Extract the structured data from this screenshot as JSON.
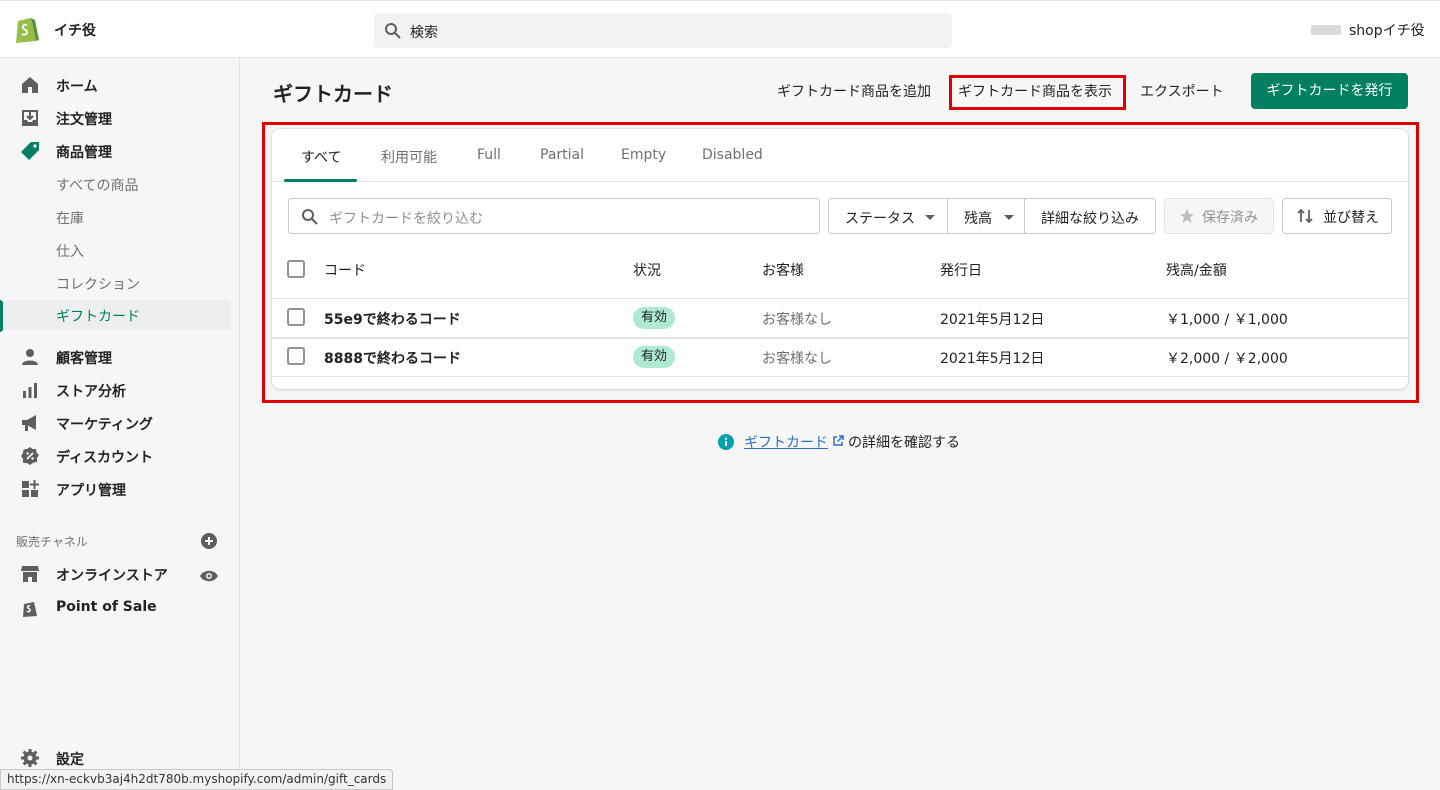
{
  "header": {
    "store_name": "イチ役",
    "search_placeholder": "検索",
    "shop_name": "shopイチ役"
  },
  "sidebar": {
    "items": [
      {
        "label": "ホーム",
        "icon": "home-icon"
      },
      {
        "label": "注文管理",
        "icon": "orders-icon"
      },
      {
        "label": "商品管理",
        "icon": "tag-icon"
      },
      {
        "label": "顧客管理",
        "icon": "customer-icon"
      },
      {
        "label": "ストア分析",
        "icon": "analytics-icon"
      },
      {
        "label": "マーケティング",
        "icon": "megaphone-icon"
      },
      {
        "label": "ディスカウント",
        "icon": "discount-icon"
      },
      {
        "label": "アプリ管理",
        "icon": "apps-icon"
      }
    ],
    "sub_items": [
      "すべての商品",
      "在庫",
      "仕入",
      "コレクション",
      "ギフトカード"
    ],
    "sales_channels_title": "販売チャネル",
    "channels": [
      {
        "label": "オンラインストア",
        "icon": "store-icon"
      },
      {
        "label": "Point of Sale",
        "icon": "pos-icon"
      }
    ],
    "settings_label": "設定"
  },
  "page": {
    "title": "ギフトカード",
    "actions": {
      "add_product": "ギフトカード商品を追加",
      "view_products": "ギフトカード商品を表示",
      "export": "エクスポート",
      "issue": "ギフトカードを発行"
    }
  },
  "tabs": [
    "すべて",
    "利用可能",
    "Full",
    "Partial",
    "Empty",
    "Disabled"
  ],
  "filters": {
    "search_placeholder": "ギフトカードを絞り込む",
    "status": "ステータス",
    "balance": "残高",
    "more": "詳細な絞り込み",
    "saved": "保存済み",
    "sort": "並び替え"
  },
  "table": {
    "headers": [
      "コード",
      "状況",
      "お客様",
      "発行日",
      "残高/金額"
    ],
    "rows": [
      {
        "code": "55e9で終わるコード",
        "status": "有効",
        "customer": "お客様なし",
        "date": "2021年5月12日",
        "balance": "￥1,000 / ￥1,000"
      },
      {
        "code": "8888で終わるコード",
        "status": "有効",
        "customer": "お客様なし",
        "date": "2021年5月12日",
        "balance": "￥2,000 / ￥2,000"
      }
    ]
  },
  "footer_info": {
    "link": "ギフトカード",
    "rest": "の詳細を確認する"
  },
  "status_url": "https://xn-eckvb3aj4h2dt780b.myshopify.com/admin/gift_cards",
  "colors": {
    "accent": "#008060",
    "highlight": "#e00000",
    "badge": "#aee9d1"
  }
}
